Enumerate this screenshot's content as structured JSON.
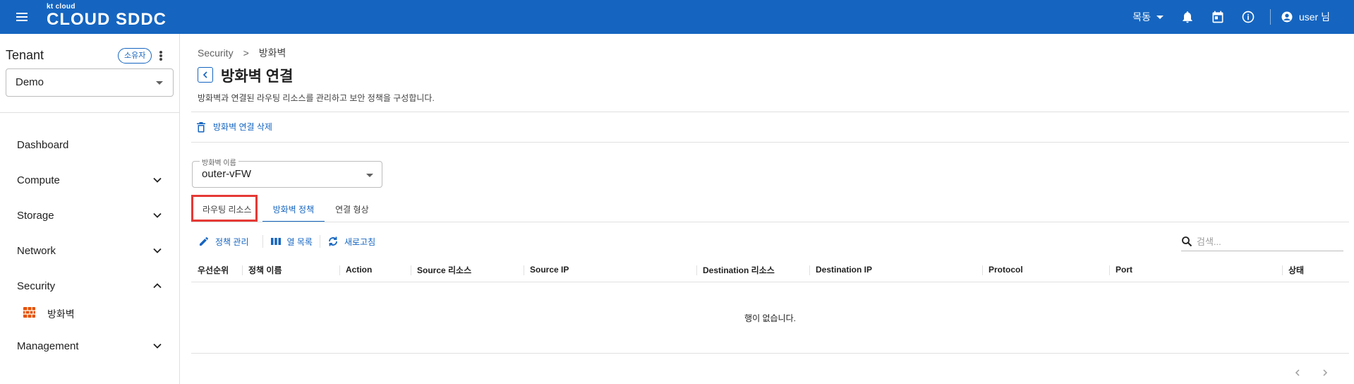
{
  "topbar": {
    "logo_small": "kt cloud",
    "logo_big": "CLOUD SDDC",
    "region": "목동",
    "user": "user 님",
    "icons": [
      "menu-icon",
      "bell-icon",
      "calendar-icon",
      "info-icon",
      "account-icon"
    ]
  },
  "sidebar": {
    "tenant_title": "Tenant",
    "owner_badge": "소유자",
    "tenant_value": "Demo",
    "items": [
      {
        "label": "Dashboard"
      },
      {
        "label": "Compute"
      },
      {
        "label": "Storage"
      },
      {
        "label": "Network"
      },
      {
        "label": "Security"
      },
      {
        "label": "방화벽"
      },
      {
        "label": "Management"
      }
    ]
  },
  "main": {
    "breadcrumb": {
      "parent": "Security",
      "separator": ">",
      "current": "방화벽"
    },
    "title": "방화벽 연결",
    "description": "방화벽과 연결된 라우팅 리소스를 관리하고 보안 정책을 구성합니다.",
    "delete_action": "방화벽 연결 삭제",
    "firewall_select": {
      "label": "방화벽 이름",
      "value": "outer-vFW"
    },
    "tabs": [
      {
        "label": "라우팅 리소스"
      },
      {
        "label": "방화벽 정책",
        "active": true
      },
      {
        "label": "연결 형상"
      }
    ],
    "toolbar": {
      "policy_manage": "정책 관리",
      "column_list": "열 목록",
      "refresh": "새로고침",
      "search_placeholder": "검색..."
    },
    "table": {
      "columns": [
        "우선순위",
        "정책 이름",
        "Action",
        "Source 리소스",
        "Source IP",
        "Destination 리소스",
        "Destination IP",
        "Protocol",
        "Port",
        "상태"
      ],
      "rows": [],
      "empty_message": "행이 없습니다."
    }
  },
  "colors": {
    "brand": "#1565c0",
    "highlight": "#e53935",
    "firewall_icon": "#e65100"
  }
}
